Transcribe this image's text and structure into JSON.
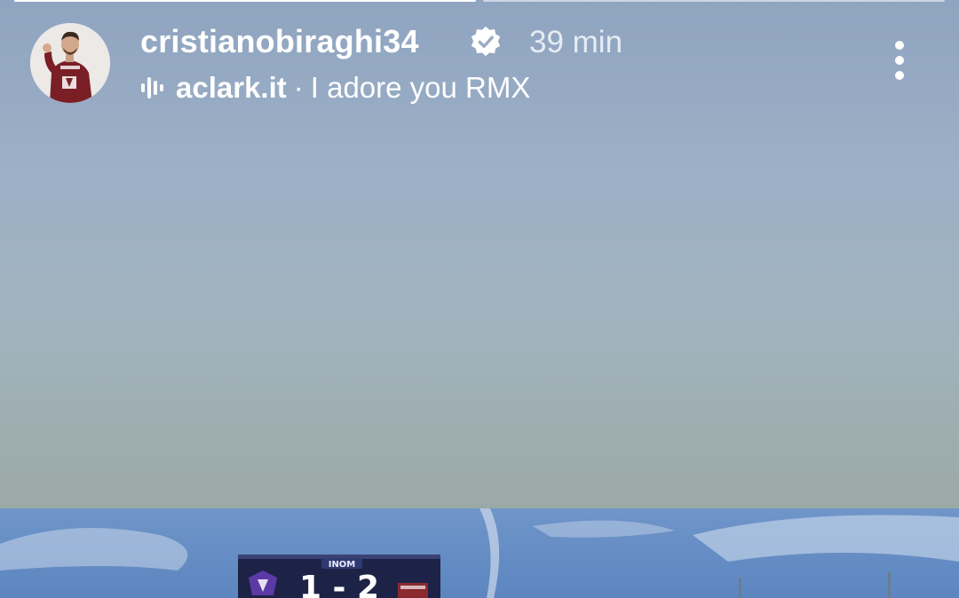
{
  "story": {
    "progress": [
      {
        "state": "viewing",
        "fraction": 1.0
      },
      {
        "state": "upcoming",
        "fraction": 0.0
      }
    ]
  },
  "header": {
    "username": "cristianobiraghi34",
    "verified": true,
    "verified_icon": "verified-badge-icon",
    "time": "39 min",
    "music": {
      "icon": "audio-waveform-icon",
      "artist": "aclark.it",
      "separator": "·",
      "track": "I adore you RMX"
    },
    "menu_icon": "more-vertical-icon"
  },
  "photo": {
    "scoreboard": {
      "brand": "INOM",
      "score": "1 - 2"
    }
  },
  "colors": {
    "background_top": "#8fa4c0",
    "background_bottom": "#9aa6a3",
    "text": "#ffffff",
    "jersey": "#7a1f25"
  }
}
